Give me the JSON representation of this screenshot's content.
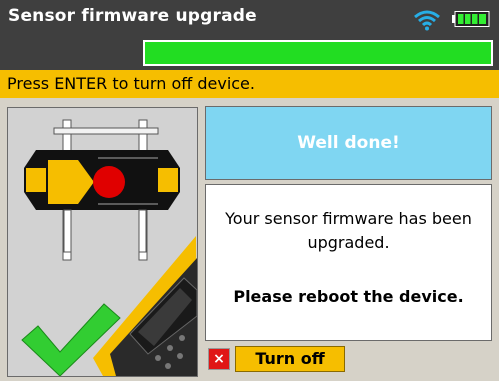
{
  "header": {
    "title": "Sensor firmware upgrade",
    "progress": 1.0
  },
  "banner": {
    "text": "Press ENTER to turn off device."
  },
  "result": {
    "heading": "Well done!",
    "message": "Your sensor firmware has been upgraded.",
    "instruction": "Please reboot the device."
  },
  "actions": {
    "close_icon_glyph": "×",
    "turn_off_label": "Turn off"
  },
  "icons": [
    "wifi-icon",
    "battery-icon",
    "sensor-illustration",
    "handheld-device-illustration",
    "checkmark-icon",
    "close-icon"
  ],
  "colors": {
    "header_bg": "#3f3f3f",
    "accent_yellow": "#f6be00",
    "progress_green": "#22dd22",
    "success_blue": "#7fd6f2",
    "close_red": "#e01616"
  }
}
